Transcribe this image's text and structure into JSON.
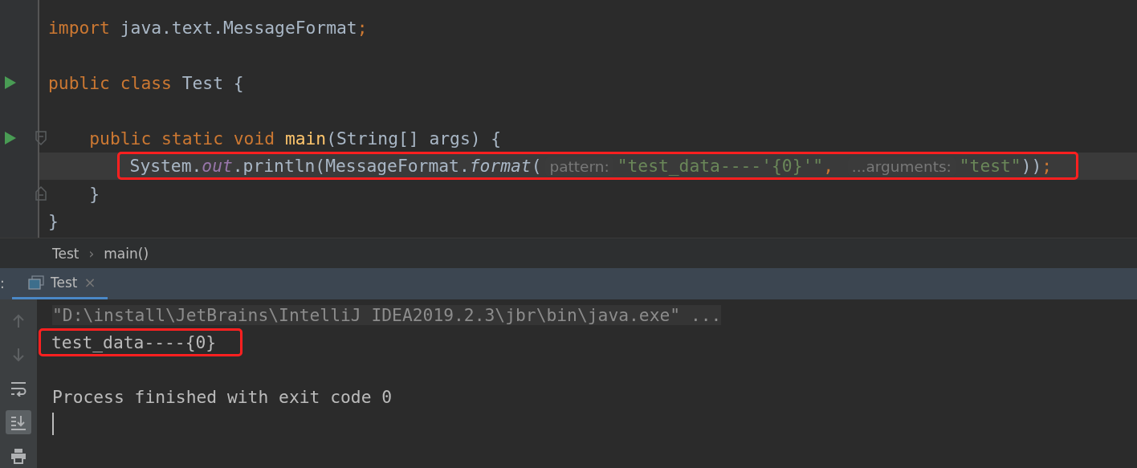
{
  "editor": {
    "lines": [
      {
        "run": false,
        "fold_open": false,
        "fold_close": false,
        "current": false,
        "highlighted": false,
        "tokens": [
          {
            "kind": "keyword",
            "text": "import"
          },
          {
            "kind": "plain",
            "text": " java.text.MessageFormat"
          },
          {
            "kind": "punct",
            "text": ";"
          }
        ]
      },
      {
        "run": false,
        "fold_open": false,
        "fold_close": false,
        "current": false,
        "highlighted": false
      },
      {
        "run": true,
        "fold_open": false,
        "fold_close": false,
        "current": false,
        "highlighted": false,
        "tokens": [
          {
            "kind": "keyword",
            "text": "public class "
          },
          {
            "kind": "plain",
            "text": "Test {"
          }
        ],
        "children": [
          {
            "run": false,
            "fold_open": false,
            "fold_close": false,
            "current": false,
            "highlighted": false
          },
          {
            "run": true,
            "fold_open": true,
            "fold_close": false,
            "current": false,
            "highlighted": false,
            "tokens": [
              {
                "kind": "keyword",
                "text": "public static void "
              },
              {
                "kind": "method",
                "text": "main"
              },
              {
                "kind": "plain",
                "text": "(String[] args) {"
              }
            ],
            "children": [
              {
                "run": false,
                "fold_open": false,
                "fold_close": false,
                "current": true,
                "highlighted": true,
                "tokens": [
                  {
                    "kind": "plain",
                    "text": "System."
                  },
                  {
                    "kind": "static-field",
                    "text": "out"
                  },
                  {
                    "kind": "plain",
                    "text": ".println(MessageFormat."
                  },
                  {
                    "kind": "static-method",
                    "text": "format"
                  },
                  {
                    "kind": "plain",
                    "text": "("
                  },
                  {
                    "kind": "hint",
                    "text": "pattern:"
                  },
                  {
                    "kind": "string",
                    "text": "\"test_data----'{0}'\""
                  },
                  {
                    "kind": "punct",
                    "text": ", "
                  },
                  {
                    "kind": "hint",
                    "text": "...arguments:"
                  },
                  {
                    "kind": "string",
                    "text": "\"test\""
                  },
                  {
                    "kind": "plain",
                    "text": "))"
                  },
                  {
                    "kind": "punct",
                    "text": ";"
                  }
                ]
              }
            ]
          },
          {
            "run": false,
            "fold_open": false,
            "fold_close": true,
            "current": false,
            "highlighted": false,
            "tokens": [
              {
                "kind": "plain",
                "text": "}"
              }
            ]
          }
        ]
      },
      {
        "run": false,
        "fold_open": false,
        "fold_close": false,
        "current": false,
        "highlighted": false,
        "tokens": [
          {
            "kind": "plain",
            "text": "}"
          }
        ]
      }
    ]
  },
  "breadcrumbs": {
    "items": [
      "Test",
      "main()"
    ],
    "separator": "›"
  },
  "run_panel": {
    "label": ":",
    "tabs": [
      {
        "label": "Test",
        "selected": true,
        "close": "×"
      }
    ],
    "toolbar": [
      {
        "kind": "up",
        "disabled": true,
        "selected": false
      },
      {
        "kind": "down",
        "disabled": true,
        "selected": false
      },
      {
        "kind": "wrap",
        "disabled": false,
        "selected": false
      },
      {
        "kind": "scroll-end",
        "disabled": false,
        "selected": true
      },
      {
        "kind": "print",
        "disabled": false,
        "selected": false
      }
    ],
    "output": [
      {
        "kind": "command",
        "text": "\"D:\\install\\JetBrains\\IntelliJ IDEA2019.2.3\\jbr\\bin\\java.exe\" ...",
        "highlighted": false
      },
      {
        "kind": "stdout",
        "text": "test_data----{0}",
        "highlighted": true
      },
      {
        "kind": "blank",
        "highlighted": false
      },
      {
        "kind": "system",
        "text": "Process finished with exit code 0",
        "highlighted": false
      },
      {
        "kind": "cursor",
        "highlighted": false
      }
    ]
  }
}
